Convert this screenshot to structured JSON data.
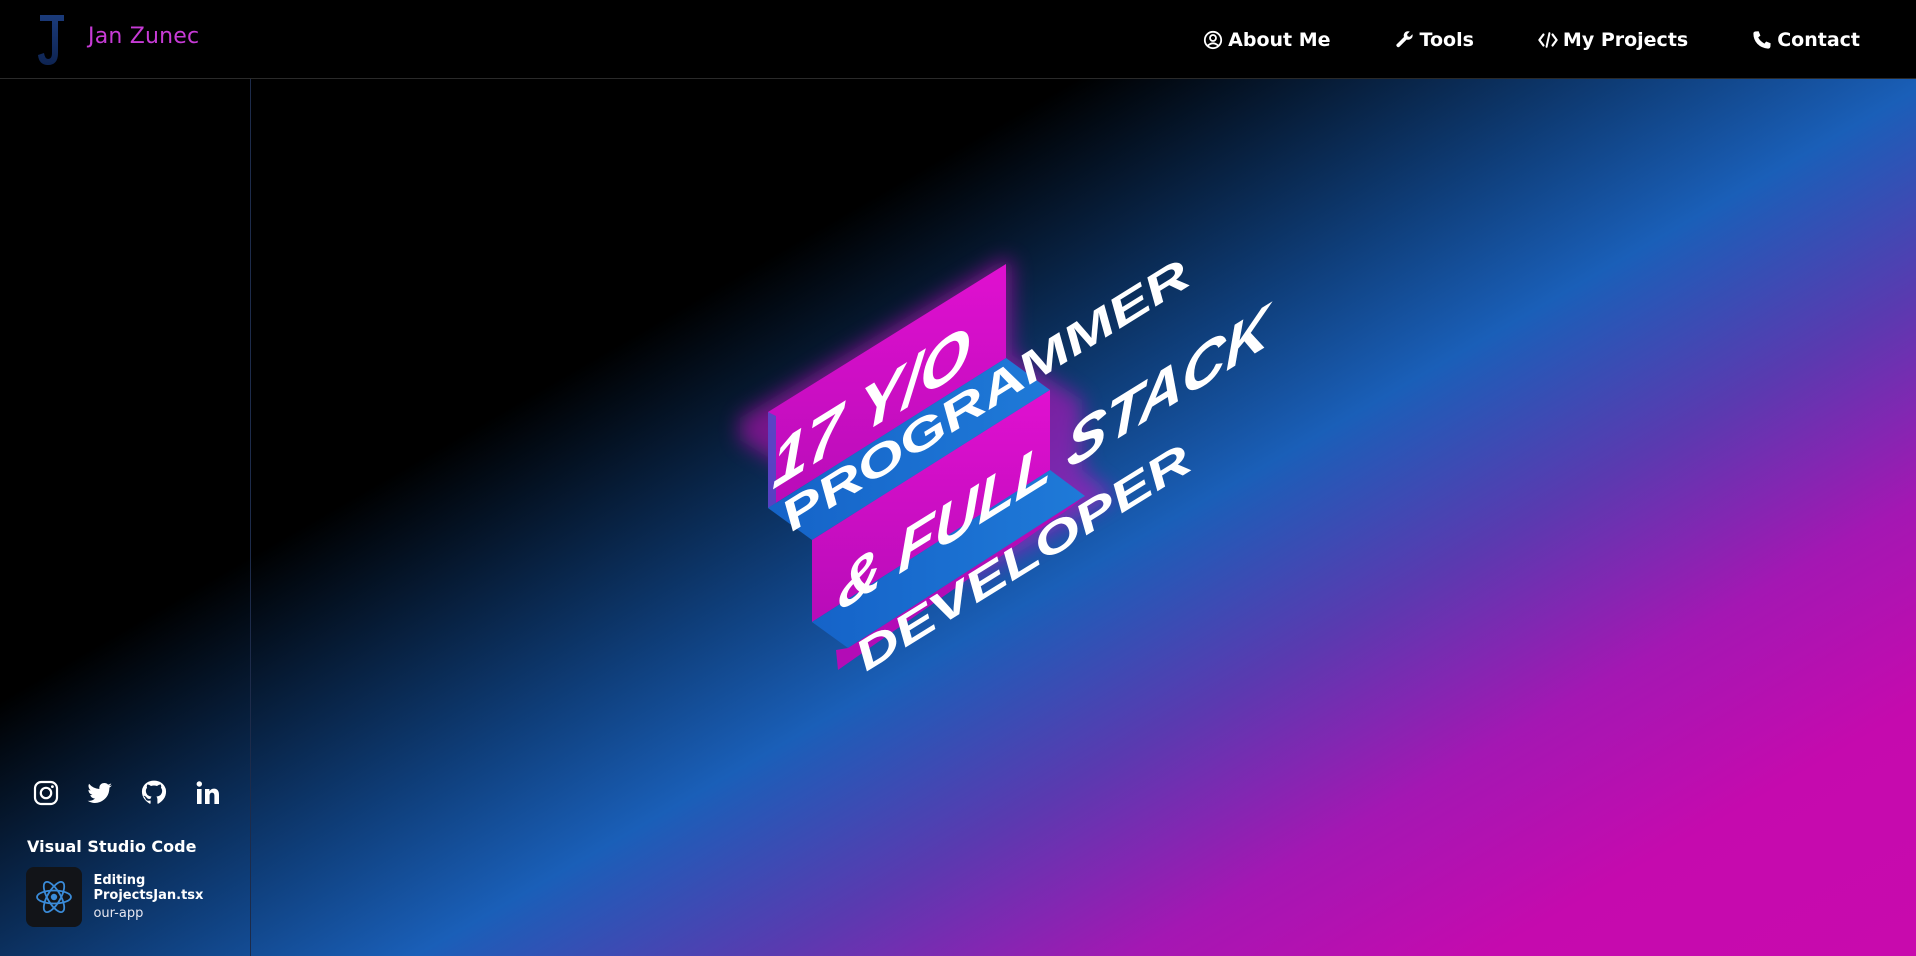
{
  "brand": {
    "name": "Jan Zunec",
    "logo_letter": "J"
  },
  "nav": [
    {
      "label": "About Me",
      "icon": "user-circle-icon"
    },
    {
      "label": "Tools",
      "icon": "wrench-icon"
    },
    {
      "label": "My Projects",
      "icon": "code-icon"
    },
    {
      "label": "Contact",
      "icon": "phone-icon"
    }
  ],
  "hero": {
    "lines": [
      "17 Y/O",
      "PROGRAMMER",
      "& FULL STACK",
      "DEVELOPER"
    ]
  },
  "socials": [
    "instagram-icon",
    "twitter-icon",
    "github-icon",
    "linkedin-icon"
  ],
  "activity": {
    "app": "Visual Studio Code",
    "details": "Editing ProjectsJan.tsx",
    "state": "our-app",
    "icon": "react-icon"
  },
  "colors": {
    "accent_magenta": "#d10bc4",
    "accent_blue": "#1a6fd1",
    "brand_text": "#c73bd6"
  }
}
